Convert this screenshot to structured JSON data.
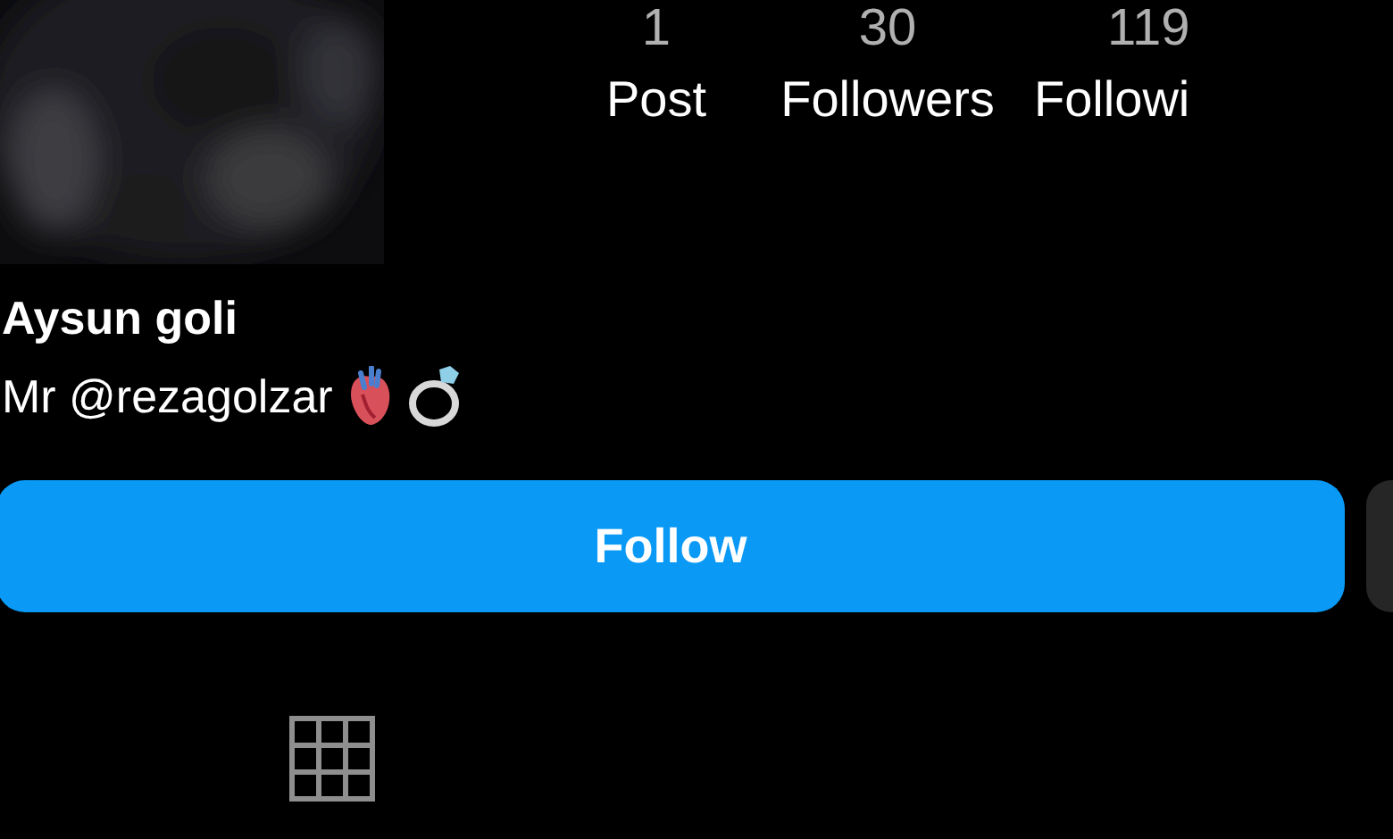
{
  "stats": [
    {
      "count": "1",
      "label": "Post"
    },
    {
      "count": "30",
      "label": "Followers"
    },
    {
      "count": "119",
      "label": "Followi"
    }
  ],
  "profile": {
    "name": "Aysun goli",
    "bio": "Mr @rezagolzar"
  },
  "follow_button": {
    "label": "Follow"
  },
  "tabs": [
    {
      "kind": "grid",
      "selected": true
    }
  ]
}
